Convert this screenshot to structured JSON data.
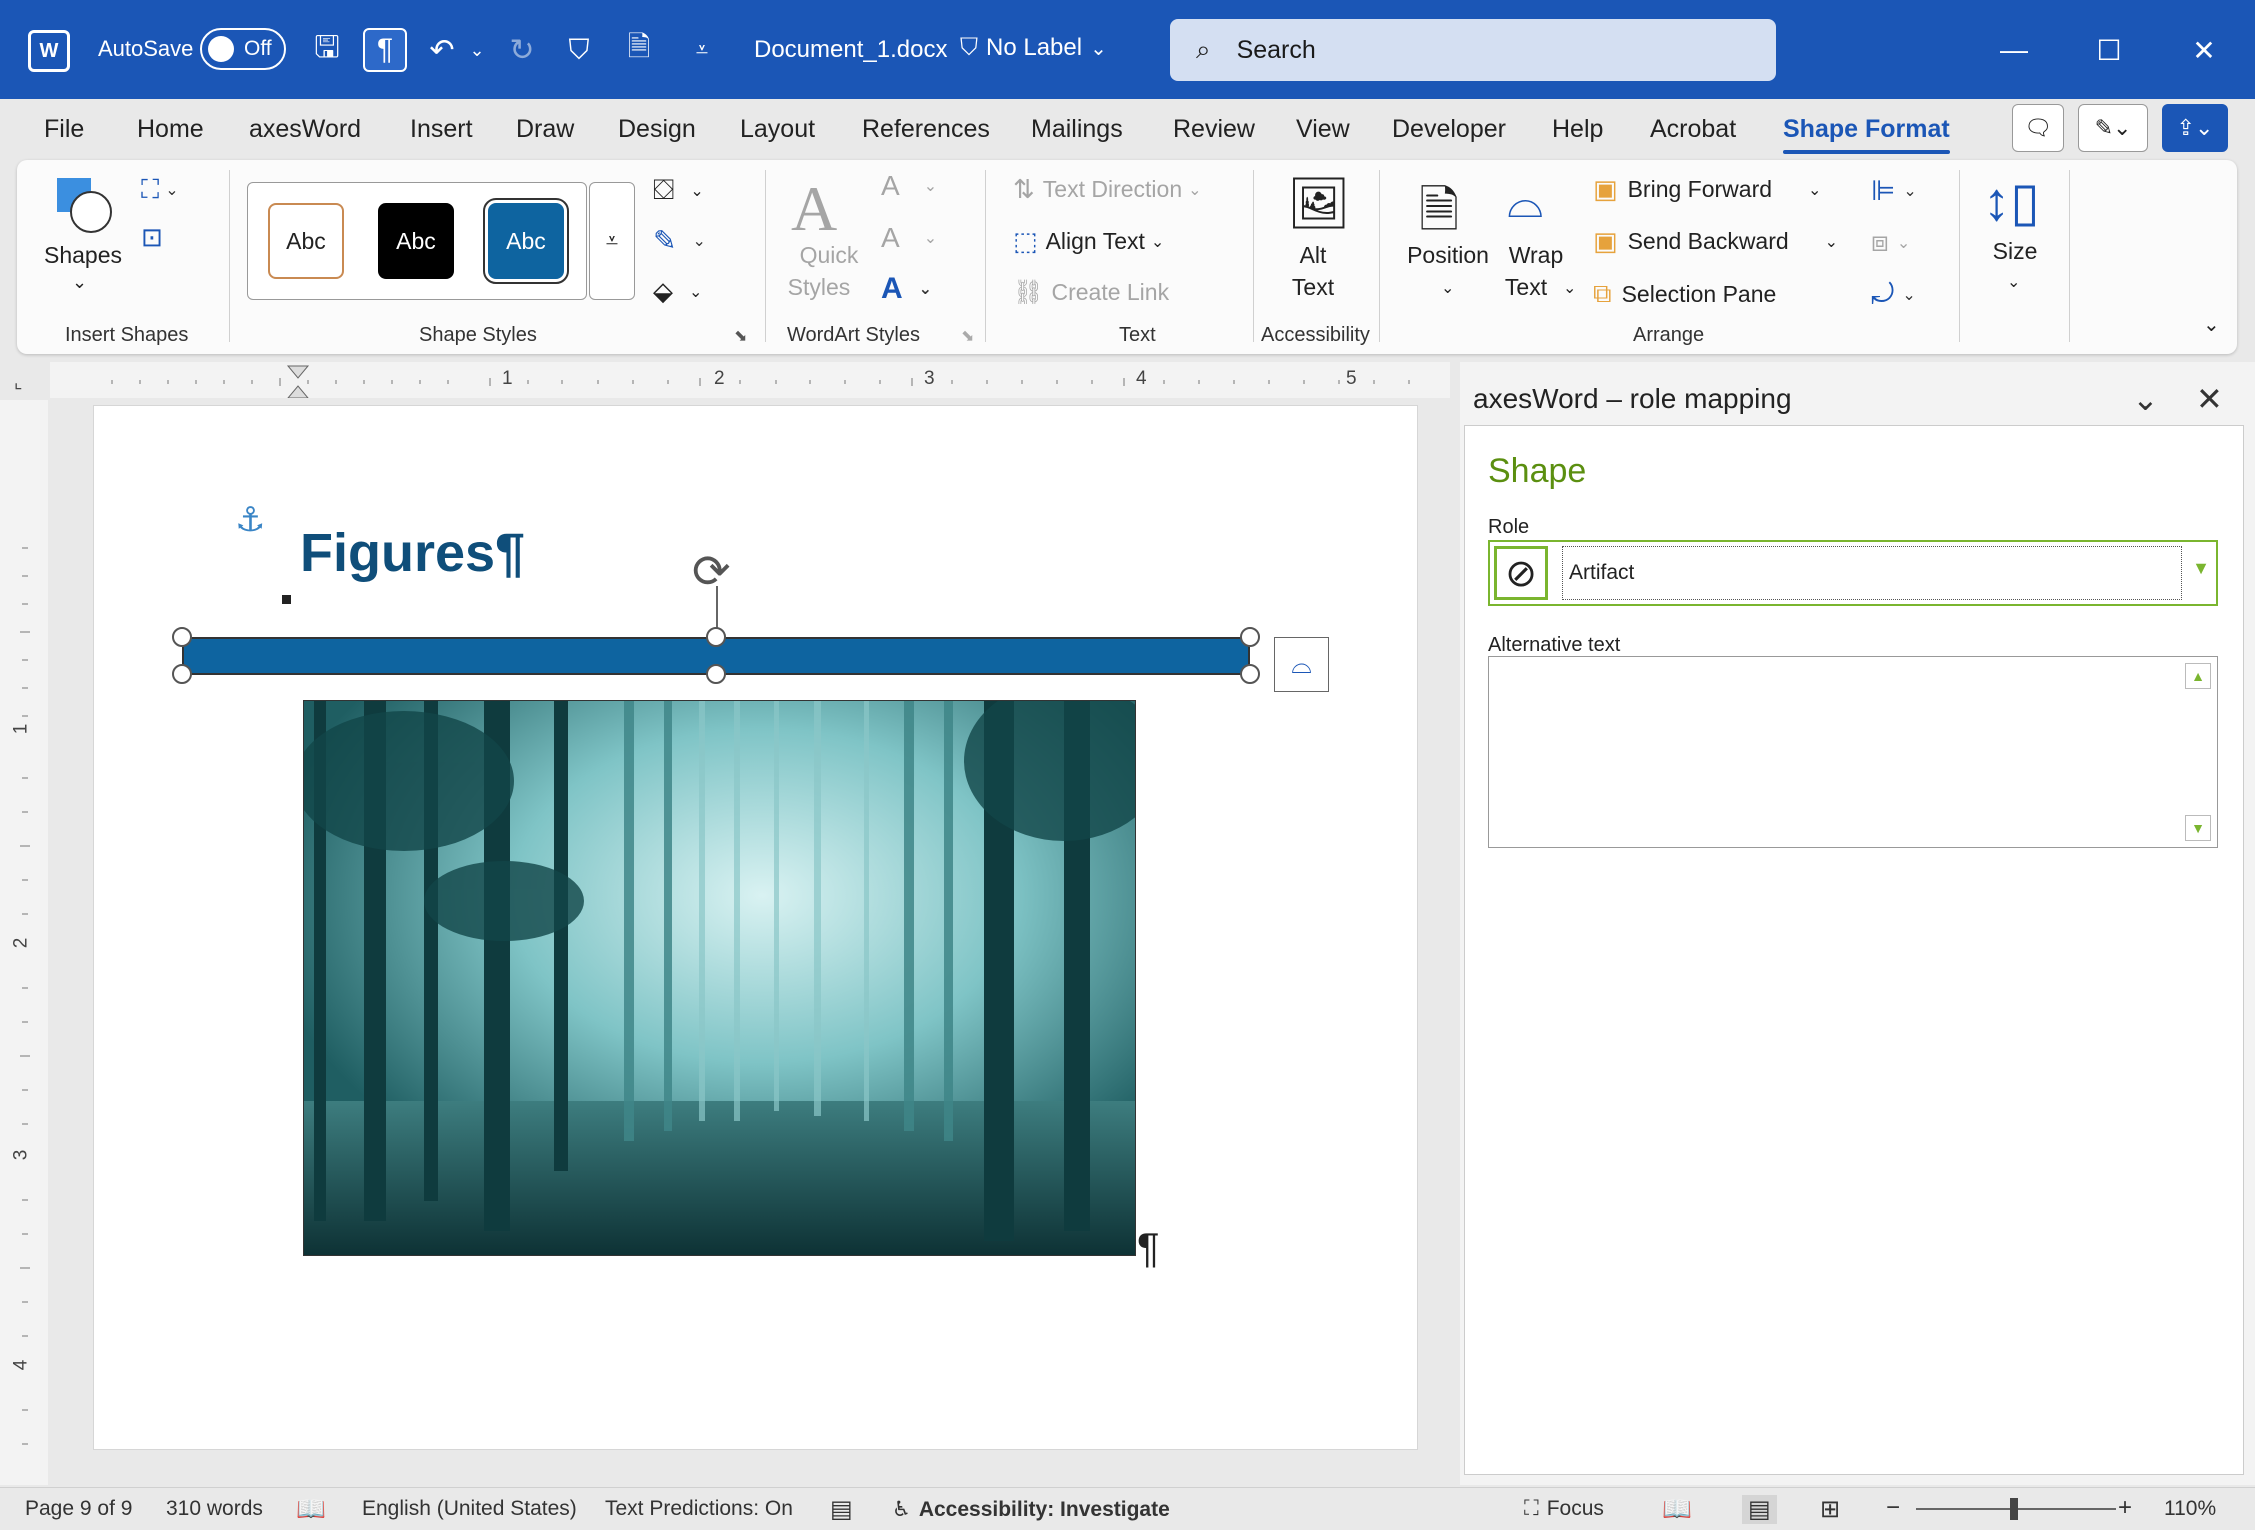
{
  "titlebar": {
    "autosave_label": "AutoSave",
    "autosave_state": "Off",
    "document_title": "Document_1.docx",
    "sensitivity_label": "No Label",
    "search_placeholder": "Search"
  },
  "tabs": [
    "File",
    "Home",
    "axesWord",
    "Insert",
    "Draw",
    "Design",
    "Layout",
    "References",
    "Mailings",
    "Review",
    "View",
    "Developer",
    "Help",
    "Acrobat",
    "Shape Format"
  ],
  "active_tab": "Shape Format",
  "ribbon": {
    "insert_shapes": {
      "shapes_label": "Shapes",
      "group_label": "Insert Shapes"
    },
    "shape_styles": {
      "abc1": "Abc",
      "abc2": "Abc",
      "abc3": "Abc",
      "group_label": "Shape Styles"
    },
    "wordart": {
      "quick_styles_line1": "Quick",
      "quick_styles_line2": "Styles",
      "group_label": "WordArt Styles"
    },
    "text": {
      "text_direction": "Text Direction",
      "align_text": "Align Text",
      "create_link": "Create Link",
      "group_label": "Text"
    },
    "accessibility": {
      "alt_line1": "Alt",
      "alt_line2": "Text",
      "group_label": "Accessibility"
    },
    "arrange": {
      "position": "Position",
      "wrap_line1": "Wrap",
      "wrap_line2": "Text",
      "bring_forward": "Bring Forward",
      "send_backward": "Send Backward",
      "selection_pane": "Selection Pane",
      "group_label": "Arrange"
    },
    "size": {
      "label": "Size"
    }
  },
  "ruler": {
    "h_numbers": [
      "1",
      "2",
      "3",
      "4",
      "5"
    ],
    "v_numbers": [
      "1",
      "2",
      "3",
      "4"
    ]
  },
  "document": {
    "heading": "Figures¶",
    "pilcrow": "¶"
  },
  "pane": {
    "title": "axesWord – role mapping",
    "section": "Shape",
    "role_label": "Role",
    "role_value": "Artifact",
    "alt_text_label": "Alternative text",
    "alt_text_value": ""
  },
  "status": {
    "page": "Page 9 of 9",
    "words": "310 words",
    "language": "English (United States)",
    "predictions": "Text Predictions: On",
    "accessibility": "Accessibility: Investigate",
    "focus": "Focus",
    "zoom": "110%"
  },
  "colors": {
    "accent": "#1b56b6",
    "shape_fill": "#0e64a0",
    "pane_green": "#5b8f10"
  }
}
